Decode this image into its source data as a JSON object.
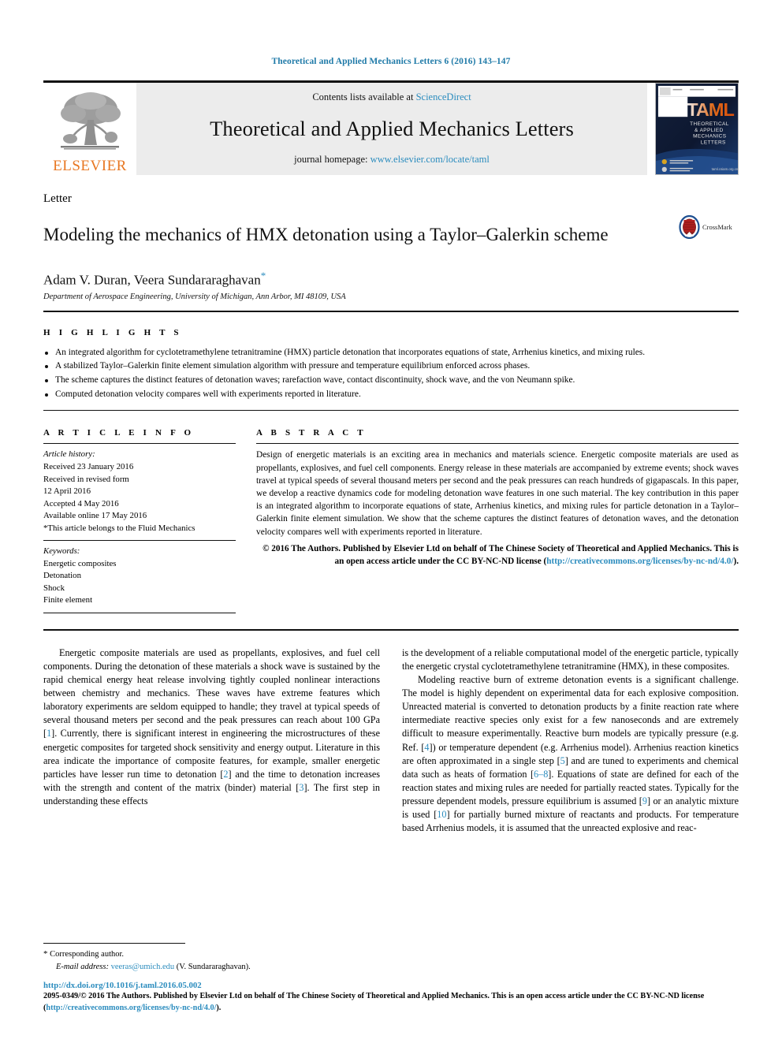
{
  "running_head": "Theoretical and Applied Mechanics Letters 6 (2016) 143–147",
  "masthead": {
    "publisher_name": "ELSEVIER",
    "contents_prefix": "Contents lists available at ",
    "contents_link": "ScienceDirect",
    "journal_title": "Theoretical and Applied Mechanics Letters",
    "homepage_prefix": "journal homepage: ",
    "homepage_url": "www.elsevier.com/locate/taml",
    "cover": {
      "acronym": "TAML",
      "line1": "THEORETICAL",
      "line2": "& APPLIED",
      "line3": "MECHANICS",
      "line4": "LETTERS",
      "site": "taml.csiam.org.cn"
    }
  },
  "article": {
    "type": "Letter",
    "title": "Modeling the mechanics of HMX detonation using a Taylor–Galerkin scheme",
    "crossmark_label": "CrossMark",
    "authors": "Adam V. Duran, Veera Sundararaghavan",
    "author_star": "*",
    "affiliation": "Department of Aerospace Engineering, University of Michigan, Ann Arbor, MI 48109, USA"
  },
  "highlights": {
    "label": "H I G H L I G H T S",
    "items": [
      "An integrated algorithm for cyclotetramethylene tetranitramine (HMX) particle detonation that incorporates equations of state, Arrhenius kinetics, and mixing rules.",
      "A stabilized Taylor–Galerkin finite element simulation algorithm with pressure and temperature equilibrium enforced across phases.",
      "The scheme captures the distinct features of detonation waves; rarefaction wave, contact discontinuity, shock wave, and the von Neumann spike.",
      "Computed detonation velocity compares well with experiments reported in literature."
    ]
  },
  "article_info": {
    "label": "A R T I C L E   I N F O",
    "history_label": "Article history:",
    "history": [
      "Received 23 January 2016",
      "Received in revised form",
      "12 April 2016",
      "Accepted 4 May 2016",
      "Available online 17 May 2016",
      "*This article belongs to the Fluid Mechanics"
    ],
    "keywords_label": "Keywords:",
    "keywords": [
      "Energetic composites",
      "Detonation",
      "Shock",
      "Finite element"
    ]
  },
  "abstract": {
    "label": "A B S T R A C T",
    "text": "Design of energetic materials is an exciting area in mechanics and materials science. Energetic composite materials are used as propellants, explosives, and fuel cell components. Energy release in these materials are accompanied by extreme events; shock waves travel at typical speeds of several thousand meters per second and the peak pressures can reach hundreds of gigapascals. In this paper, we develop a reactive dynamics code for modeling detonation wave features in one such material. The key contribution in this paper is an integrated algorithm to incorporate equations of state, Arrhenius kinetics, and mixing rules for particle detonation in a Taylor–Galerkin finite element simulation. We show that the scheme captures the distinct features of detonation waves, and the detonation velocity compares well with experiments reported in literature.",
    "copyright_text": "© 2016 The Authors. Published by Elsevier Ltd on behalf of The Chinese Society of Theoretical and Applied Mechanics. This is an open access article under the CC BY-NC-ND license (",
    "copyright_link": "http://creativecommons.org/licenses/by-nc-nd/4.0/",
    "copyright_tail": ")."
  },
  "body": {
    "left_paragraphs": [
      "Energetic composite materials are used as propellants, explosives, and fuel cell components. During the detonation of these materials a shock wave is sustained by the rapid chemical energy heat release involving tightly coupled nonlinear interactions between chemistry and mechanics. These waves have extreme features which laboratory experiments are seldom equipped to handle; they travel at typical speeds of several thousand meters per second and the peak pressures can reach about 100 GPa [1]. Currently, there is significant interest in engineering the microstructures of these energetic composites for targeted shock sensitivity and energy output. Literature in this area indicate the importance of composite features, for example, smaller energetic particles have lesser run time to detonation [2] and the time to detonation increases with the strength and content of the matrix (binder) material [3]. The first step in understanding these effects"
    ],
    "right_paragraphs": [
      "is the development of a reliable computational model of the energetic particle, typically the energetic crystal cyclotetramethylene tetranitramine (HMX), in these composites.",
      "Modeling reactive burn of extreme detonation events is a significant challenge. The model is highly dependent on experimental data for each explosive composition. Unreacted material is converted to detonation products by a finite reaction rate where intermediate reactive species only exist for a few nanoseconds and are extremely difficult to measure experimentally. Reactive burn models are typically pressure (e.g. Ref. [4]) or temperature dependent (e.g. Arrhenius model). Arrhenius reaction kinetics are often approximated in a single step [5] and are tuned to experiments and chemical data such as heats of formation [6–8]. Equations of state are defined for each of the reaction states and mixing rules are needed for partially reacted states. Typically for the pressure dependent models, pressure equilibrium is assumed [9] or an analytic mixture is used [10] for partially burned mixture of reactants and products. For temperature based Arrhenius models, it is assumed that the unreacted explosive and reac-"
    ]
  },
  "footnotes": {
    "corresponding_star": "*",
    "corresponding_label": "Corresponding author.",
    "email_label": "E-mail address:",
    "email": "veeras@umich.edu",
    "email_owner": "(V. Sundararaghavan).",
    "doi": "http://dx.doi.org/10.1016/j.taml.2016.05.002",
    "issn_text": "2095-0349/© 2016 The Authors. Published by Elsevier Ltd on behalf of The Chinese Society of Theoretical and Applied Mechanics. This is an open access article under the CC BY-NC-ND license (",
    "issn_link": "http://creativecommons.org/licenses/by-nc-nd/4.0/",
    "issn_tail": ")."
  },
  "colors": {
    "link_blue": "#2b8cbe",
    "elsevier_orange": "#E87722",
    "masthead_grey": "#ececec"
  }
}
